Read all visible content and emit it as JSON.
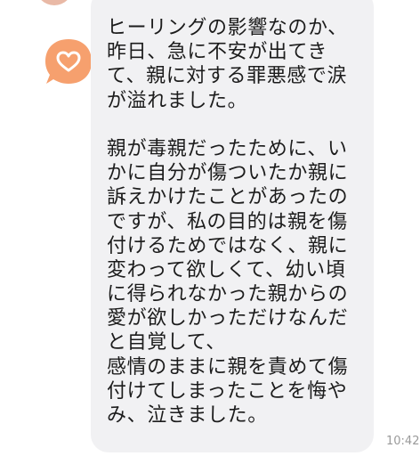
{
  "message": {
    "lines": [
      "ヒーリングの影響なのか、",
      "昨日、急に不安が出てき",
      "て、親に対する罪悪感で涙",
      "が溢れました。",
      "",
      "親が毒親だったために、い",
      "かに自分が傷ついたか親に",
      "訴えかけたことがあったの",
      "ですが、私の目的は親を傷",
      "付けるためではなく、親に",
      "変わって欲しくて、幼い頃",
      "に得られなかった親からの",
      "愛が欲しかっただけなんだ",
      "と自覚して、",
      "感情のままに親を責めて傷",
      "付けてしまったことを悔や",
      "み、泣きました。"
    ],
    "timestamp": "10:42"
  },
  "avatar": {
    "icon": "heart-icon",
    "color": "#f6a06e"
  }
}
